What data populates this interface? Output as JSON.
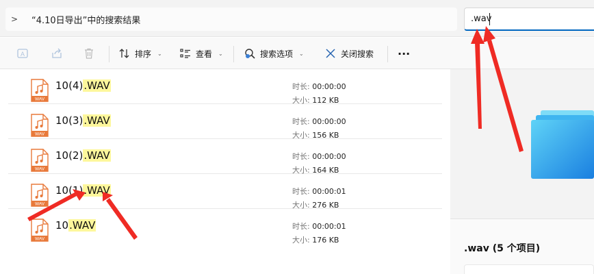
{
  "address": {
    "chevron": ">",
    "path": "“4.10日导出”中的搜索结果"
  },
  "search": {
    "value": ".wav"
  },
  "toolbar": {
    "sort_label": "排序",
    "view_label": "查看",
    "search_options_label": "搜索选项",
    "close_search_label": "关闭搜索",
    "more_label": "···"
  },
  "meta_labels": {
    "duration": "时长:",
    "size": "大小:"
  },
  "files": [
    {
      "base": "10(4)",
      "ext": ".WAV",
      "duration": "00:00:00",
      "size": "112 KB"
    },
    {
      "base": "10(3)",
      "ext": ".WAV",
      "duration": "00:00:00",
      "size": "156 KB"
    },
    {
      "base": "10(2)",
      "ext": ".WAV",
      "duration": "00:00:00",
      "size": "164 KB"
    },
    {
      "base": "10(1)",
      "ext": ".WAV",
      "duration": "00:00:01",
      "size": "276 KB"
    },
    {
      "base": "10",
      "ext": ".WAV",
      "duration": "00:00:01",
      "size": "176 KB"
    }
  ],
  "file_icon_label": "WAV",
  "preview": {
    "title": ".wav (5 个项目)"
  },
  "colors": {
    "accent": "#0067c0",
    "highlight": "#fdf79c",
    "arrow": "#ef2b24",
    "file_icon": "#e8793a"
  }
}
